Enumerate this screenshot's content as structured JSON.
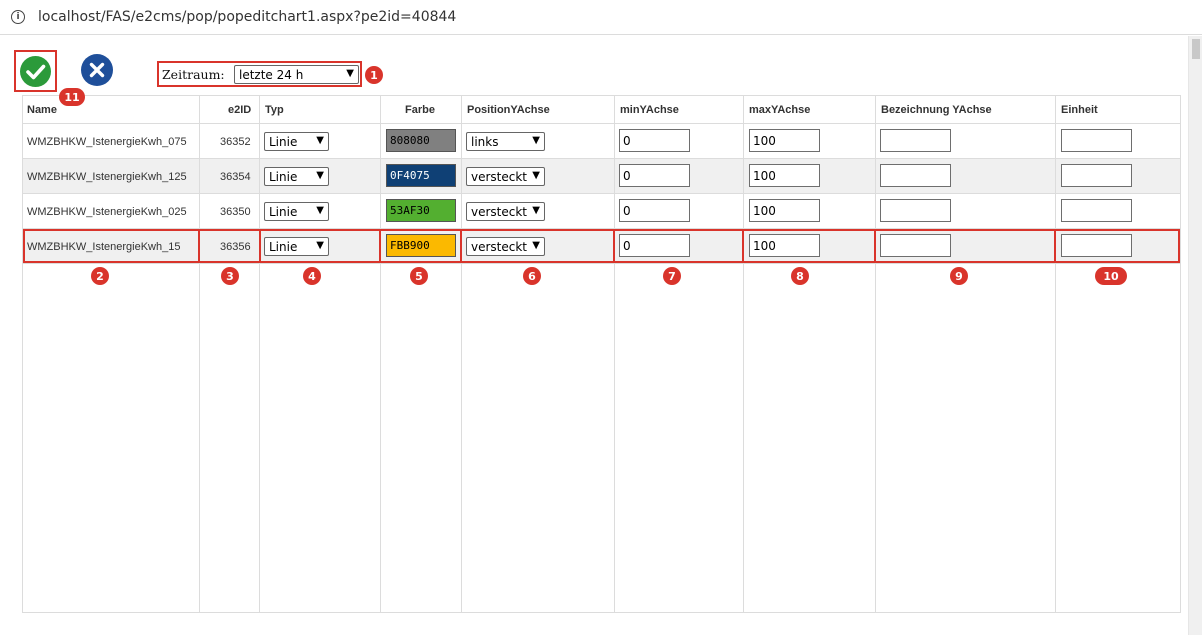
{
  "browser": {
    "url": "localhost/FAS/e2cms/pop/popeditchart1.aspx?pe2id=40844"
  },
  "toolbar": {
    "period_label": "Zeitraum:",
    "period_value": "letzte 24 h"
  },
  "table": {
    "headers": [
      "Name",
      "e2ID",
      "Typ",
      "Farbe",
      "PositionYAchse",
      "minYAchse",
      "maxYAchse",
      "Bezeichnung YAchse",
      "Einheit"
    ],
    "rows": [
      {
        "name": "WMZBHKW_IstenergieKwh_075",
        "e2id": "36352",
        "typ": "Linie",
        "farbe": "808080",
        "color": "#808080",
        "position": "links",
        "min": "0",
        "max": "100",
        "bezeichnung": "",
        "einheit": ""
      },
      {
        "name": "WMZBHKW_IstenergieKwh_125",
        "e2id": "36354",
        "typ": "Linie",
        "farbe": "0F4075",
        "color": "#0F4075",
        "position": "versteckt",
        "min": "0",
        "max": "100",
        "bezeichnung": "",
        "einheit": ""
      },
      {
        "name": "WMZBHKW_IstenergieKwh_025",
        "e2id": "36350",
        "typ": "Linie",
        "farbe": "53AF30",
        "color": "#53AF30",
        "position": "versteckt",
        "min": "0",
        "max": "100",
        "bezeichnung": "",
        "einheit": ""
      },
      {
        "name": "WMZBHKW_IstenergieKwh_15",
        "e2id": "36356",
        "typ": "Linie",
        "farbe": "FBB900",
        "color": "#FBB900",
        "position": "versteckt",
        "min": "0",
        "max": "100",
        "bezeichnung": "",
        "einheit": ""
      }
    ]
  },
  "markers": [
    "1",
    "2",
    "3",
    "4",
    "5",
    "6",
    "7",
    "8",
    "9",
    "10",
    "11"
  ],
  "colors": {
    "accent_red": "#d9342b",
    "ok_green": "#2b9a3a",
    "cancel_blue": "#1f4f9a"
  }
}
